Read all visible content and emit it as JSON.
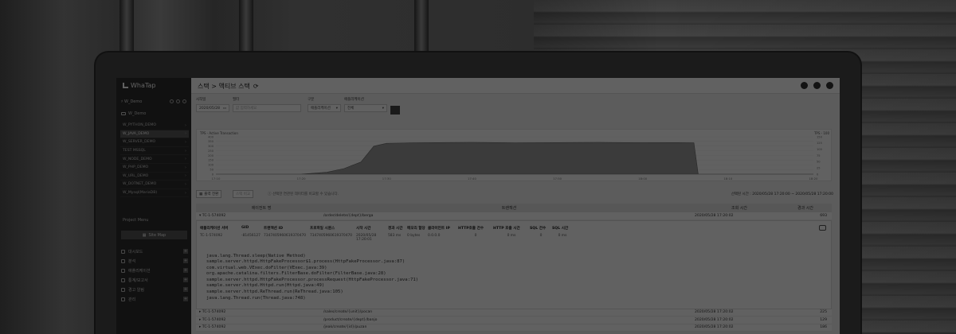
{
  "brand": {
    "name": "WhaTap"
  },
  "sidebar": {
    "project_select": "♯ W_Demo",
    "folder": "W_Demo",
    "apps": [
      {
        "label": "W_PYTHON_DEMO",
        "active": false
      },
      {
        "label": "W_JAVA_DEMO",
        "active": true
      },
      {
        "label": "W_SERVER_DEMO",
        "active": false
      },
      {
        "label": "TEST MSSQL",
        "active": false
      },
      {
        "label": "W_NODE_DEMO",
        "active": false
      },
      {
        "label": "W_PHP_DEMO",
        "active": false
      },
      {
        "label": "W_URL_DEMO",
        "active": false
      },
      {
        "label": "W_DOTNET_DEMO",
        "active": false
      },
      {
        "label": "W_Mysql(MariaDB)",
        "active": false
      }
    ],
    "project_menu_label": "Project Menu",
    "sitemap_label": "Site Map",
    "menu": [
      {
        "label": "대시보드"
      },
      {
        "label": "분석"
      },
      {
        "label": "애플리케이션"
      },
      {
        "label": "통계/보고서"
      },
      {
        "label": "경고 알림"
      },
      {
        "label": "관리"
      }
    ]
  },
  "header": {
    "title": "스택 > 액티브 스택",
    "icons": [
      "bell-icon",
      "chat-icon",
      "user-icon"
    ]
  },
  "filters": {
    "date_label": "시작일",
    "date_value": "2020/05/28",
    "time_label": "필터",
    "time_placeholder": "값 입력하세요",
    "type_label": "구분",
    "type_value": "애플리케이션",
    "app_label": "애플리케이션",
    "app_value": "전체"
  },
  "chart_data": {
    "type": "area",
    "title": "TPS - Active Transaction",
    "right_label": "TPS - 100",
    "x": [
      "17:10",
      "17:20",
      "17:30",
      "17:40",
      "17:50",
      "18:00",
      "18:10",
      "18:20"
    ],
    "ylim": [
      0,
      400
    ],
    "y_ticks_left": [
      "400",
      "350",
      "300",
      "250",
      "200",
      "150",
      "100",
      "50",
      "0"
    ],
    "y_ticks_right": [
      "150",
      "125",
      "100",
      "75",
      "50",
      "25",
      "0"
    ],
    "series": [
      {
        "points": [
          [
            0,
            0
          ],
          [
            0.5,
            0
          ],
          [
            1.0,
            0
          ],
          [
            1.3,
            20
          ],
          [
            1.5,
            60
          ],
          [
            1.7,
            130
          ],
          [
            1.85,
            300
          ],
          [
            2.0,
            330
          ],
          [
            2.3,
            335
          ],
          [
            2.6,
            338
          ],
          [
            3.0,
            340
          ],
          [
            3.5,
            336
          ],
          [
            4.0,
            338
          ],
          [
            4.5,
            340
          ],
          [
            5.0,
            337
          ],
          [
            5.4,
            338
          ],
          [
            5.6,
            336
          ],
          [
            5.65,
            0
          ],
          [
            6.0,
            0
          ],
          [
            7.0,
            0
          ]
        ]
      }
    ],
    "grid": true
  },
  "toolbar": {
    "group_btn": "출력 전환",
    "compare_btn": "스택 비교",
    "notice": "선택한 연관된 데이터를 비교할 수 있습니다.",
    "range": "선택된 시간 : 2020/05/28 17:20:00 ~ 2020/05/28 17:20:00"
  },
  "table": {
    "columns": [
      "에이전트 명",
      "트랜잭션",
      "조회 시간",
      "경과 시간"
    ],
    "expanded_row": {
      "agent": "TC-1-574092",
      "url": "/order/delete/{dept}/berga",
      "time": "2020/05/28 17:20:02",
      "elapsed": "693"
    },
    "detail_headers": [
      "애플리케이션 서버",
      "GID",
      "트랜잭션 ID",
      "프로파일 시퀀스",
      "시작 시간",
      "경과 시간",
      "메모리 할당",
      "클라이언트 IP",
      "HTTP호출 건수",
      "HTTP 호출 시간",
      "SQL 건수",
      "SQL 시간"
    ],
    "detail_values": [
      "TC-1-574092",
      "-81456127",
      "7347405960619370470",
      "7347405960619370470",
      "2020/05/28 17:20:01",
      "583 ms",
      "0 bytes",
      "0.0.0.0",
      "0",
      "0 ms",
      "0",
      "0 ms"
    ],
    "stack": [
      "java.lang.Thread.sleep(Native Method)",
      "sample.server.httpd.HttpFakeProcessor$1.process(HttpFakeProcessor.java:87)",
      "com.virtual.web.VExec.doFilter(VExec.java:39)",
      "org.apache.catalina.filters.FilterBase.doFilter(FilterBase.java:28)",
      "sample.server.httpd.HttpFakeProcessor.processRequest(HttpFakeProcessor.java:71)",
      "sample.server.httpd.Httpd.run(Httpd.java:49)",
      "sample.server.httpd.ReThread.run(ReThread.java:105)",
      "java.lang.Thread.run(Thread.java:748)"
    ],
    "rows": [
      {
        "agent": "TC-1-574092",
        "url": "/sales/create/{unit}/pocan",
        "time": "2020/05/28 17:20:02",
        "elapsed": "225"
      },
      {
        "agent": "TC-1-574092",
        "url": "/product/create/{dept}/banjo",
        "time": "2020/05/28 17:20:02",
        "elapsed": "129"
      },
      {
        "agent": "TC-1-574092",
        "url": "/jeak/create/{id}/puzan",
        "time": "2020/05/28 17:20:02",
        "elapsed": "186"
      }
    ]
  }
}
